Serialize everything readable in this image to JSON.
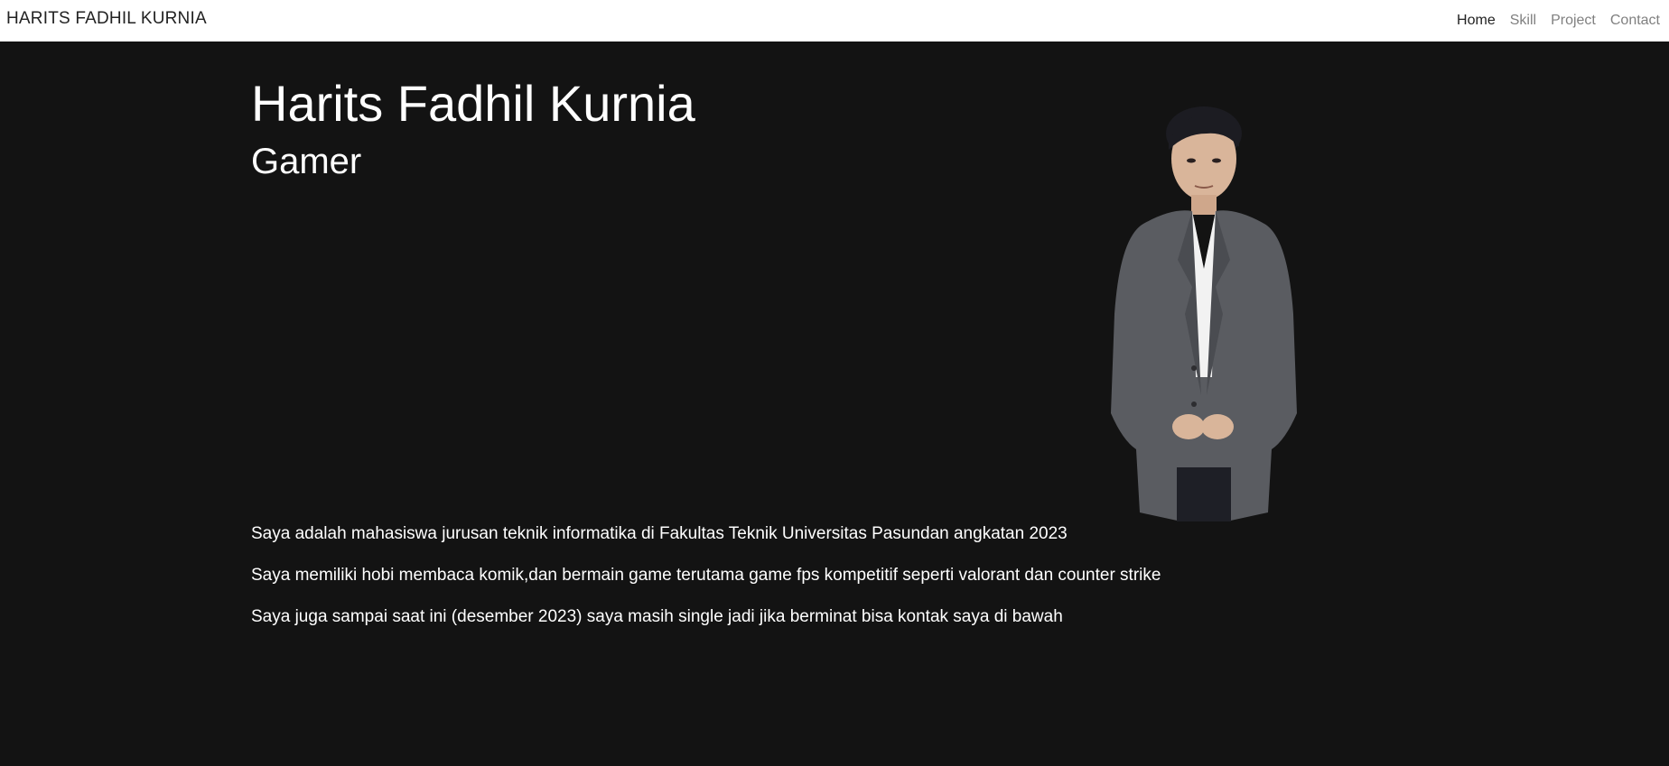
{
  "navbar": {
    "brand": "HARITS FADHIL KURNIA",
    "links": [
      "Home",
      "Skill",
      "Project",
      "Contact"
    ]
  },
  "hero": {
    "name": "Harits Fadhil Kurnia",
    "role": "Gamer",
    "bio": [
      "Saya adalah mahasiswa jurusan teknik informatika di Fakultas Teknik Universitas Pasundan angkatan 2023",
      "Saya memiliki hobi membaca komik,dan bermain game terutama game fps kompetitif seperti valorant dan counter strike",
      "Saya juga sampai saat ini (desember 2023) saya masih single jadi jika berminat bisa kontak saya di bawah"
    ]
  },
  "colors": {
    "background": "#131313",
    "navbar": "#ffffff",
    "text": "#ffffff",
    "nav_active": "#222222",
    "nav_inactive": "#808080"
  }
}
